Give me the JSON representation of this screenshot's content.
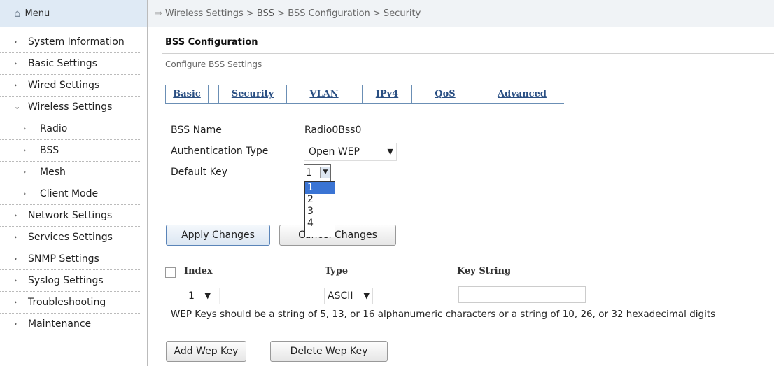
{
  "sidebar": {
    "menu_label": "Menu",
    "items": [
      {
        "label": "System Information",
        "level": "top"
      },
      {
        "label": "Basic Settings",
        "level": "top"
      },
      {
        "label": "Wired Settings",
        "level": "top"
      },
      {
        "label": "Wireless Settings",
        "level": "top",
        "expanded": true
      },
      {
        "label": "Radio",
        "level": "sub"
      },
      {
        "label": "BSS",
        "level": "sub"
      },
      {
        "label": "Mesh",
        "level": "sub"
      },
      {
        "label": "Client Mode",
        "level": "sub"
      },
      {
        "label": "Network Settings",
        "level": "top"
      },
      {
        "label": "Services Settings",
        "level": "top"
      },
      {
        "label": "SNMP Settings",
        "level": "top"
      },
      {
        "label": "Syslog Settings",
        "level": "top"
      },
      {
        "label": "Troubleshooting",
        "level": "top"
      },
      {
        "label": "Maintenance",
        "level": "top"
      }
    ]
  },
  "breadcrumb": {
    "part1": "Wireless Settings >",
    "link": "BSS",
    "part2": "> BSS Configuration > Security"
  },
  "page": {
    "title": "BSS Configuration",
    "description": "Configure BSS Settings"
  },
  "tabs": [
    {
      "label": "Basic"
    },
    {
      "label": "Security",
      "active": true
    },
    {
      "label": "VLAN"
    },
    {
      "label": "IPv4"
    },
    {
      "label": "QoS"
    },
    {
      "label": "Advanced"
    }
  ],
  "form": {
    "bss_name_label": "BSS Name",
    "bss_name_value": "Radio0Bss0",
    "auth_type_label": "Authentication Type",
    "auth_type_value": "Open WEP",
    "default_key_label": "Default Key",
    "default_key_value": "1",
    "default_key_options": [
      "1",
      "2",
      "3",
      "4"
    ]
  },
  "buttons": {
    "apply": "Apply Changes",
    "cancel": "Cancel Changes",
    "add_wep": "Add Wep Key",
    "delete_wep": "Delete Wep Key"
  },
  "wep_table": {
    "headers": [
      "Index",
      "Type",
      "Key String"
    ],
    "row": {
      "index": "1",
      "type": "ASCII",
      "key_string": ""
    },
    "note": "WEP Keys should be a string of 5, 13, or 16 alphanumeric characters or a string of 10, 26, or 32 hexadecimal digits"
  },
  "colors": {
    "tab_text": "#2a4f83",
    "tab_border": "#6b8fb5",
    "selected_option": "#3a74d4",
    "menu_header_bg": "#dfeaf5"
  }
}
